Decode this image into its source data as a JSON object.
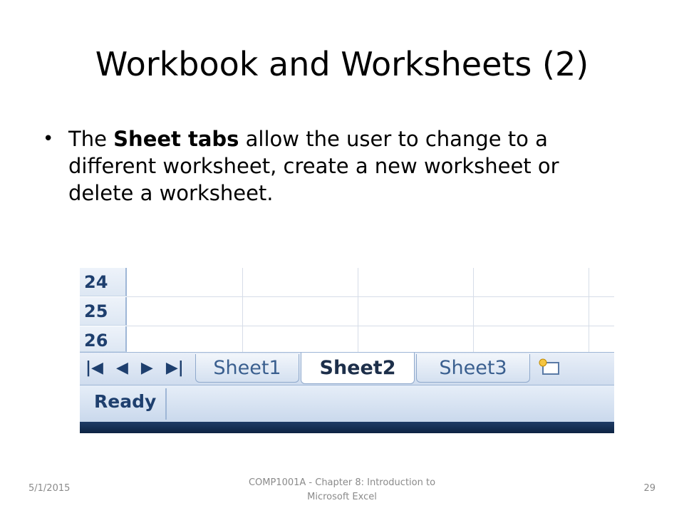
{
  "slide": {
    "title": "Workbook and Worksheets (2)",
    "bullet": {
      "prefix": "The ",
      "bold": "Sheet tabs",
      "suffix": " allow the user to change to a different worksheet, create a new worksheet or delete a worksheet."
    }
  },
  "excel": {
    "rows": [
      "24",
      "25",
      "26"
    ],
    "nav_buttons": [
      "|◀",
      "◀",
      "▶",
      "▶|"
    ],
    "tabs": [
      {
        "label": "Sheet1",
        "active": false
      },
      {
        "label": "Sheet2",
        "active": true
      },
      {
        "label": "Sheet3",
        "active": false
      }
    ],
    "new_tab_icon": "insert-worksheet-icon",
    "status": "Ready"
  },
  "footer": {
    "date": "5/1/2015",
    "center": "COMP1001A - Chapter 8: Introduction to Microsoft Excel",
    "page": "29"
  }
}
